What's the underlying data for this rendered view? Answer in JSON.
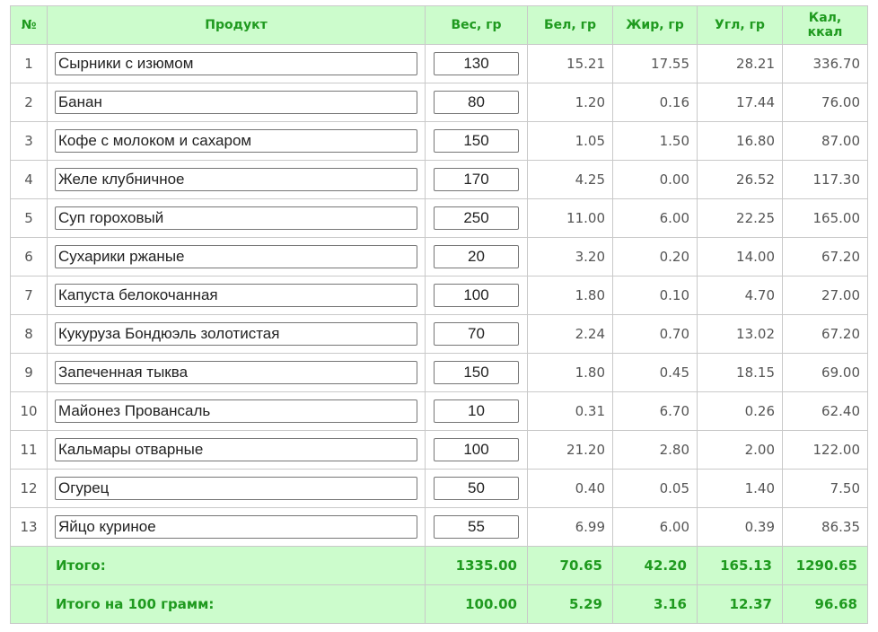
{
  "header": {
    "num": "№",
    "product": "Продукт",
    "weight": "Вес, гр",
    "protein": "Бел, гр",
    "fat": "Жир, гр",
    "carbs": "Угл, гр",
    "kcal": "Кал, ккал"
  },
  "rows": [
    {
      "num": "1",
      "product": "Сырники с изюмом",
      "weight": "130",
      "protein": "15.21",
      "fat": "17.55",
      "carbs": "28.21",
      "kcal": "336.70"
    },
    {
      "num": "2",
      "product": "Банан",
      "weight": "80",
      "protein": "1.20",
      "fat": "0.16",
      "carbs": "17.44",
      "kcal": "76.00"
    },
    {
      "num": "3",
      "product": "Кофе с молоком и сахаром",
      "weight": "150",
      "protein": "1.05",
      "fat": "1.50",
      "carbs": "16.80",
      "kcal": "87.00"
    },
    {
      "num": "4",
      "product": "Желе клубничное",
      "weight": "170",
      "protein": "4.25",
      "fat": "0.00",
      "carbs": "26.52",
      "kcal": "117.30"
    },
    {
      "num": "5",
      "product": "Суп гороховый",
      "weight": "250",
      "protein": "11.00",
      "fat": "6.00",
      "carbs": "22.25",
      "kcal": "165.00"
    },
    {
      "num": "6",
      "product": "Сухарики ржаные",
      "weight": "20",
      "protein": "3.20",
      "fat": "0.20",
      "carbs": "14.00",
      "kcal": "67.20"
    },
    {
      "num": "7",
      "product": "Капуста белокочанная",
      "weight": "100",
      "protein": "1.80",
      "fat": "0.10",
      "carbs": "4.70",
      "kcal": "27.00"
    },
    {
      "num": "8",
      "product": "Кукуруза Бондюэль золотистая",
      "weight": "70",
      "protein": "2.24",
      "fat": "0.70",
      "carbs": "13.02",
      "kcal": "67.20"
    },
    {
      "num": "9",
      "product": "Запеченная тыква",
      "weight": "150",
      "protein": "1.80",
      "fat": "0.45",
      "carbs": "18.15",
      "kcal": "69.00"
    },
    {
      "num": "10",
      "product": "Майонез Провансаль",
      "weight": "10",
      "protein": "0.31",
      "fat": "6.70",
      "carbs": "0.26",
      "kcal": "62.40"
    },
    {
      "num": "11",
      "product": "Кальмары отварные",
      "weight": "100",
      "protein": "21.20",
      "fat": "2.80",
      "carbs": "2.00",
      "kcal": "122.00"
    },
    {
      "num": "12",
      "product": "Огурец",
      "weight": "50",
      "protein": "0.40",
      "fat": "0.05",
      "carbs": "1.40",
      "kcal": "7.50"
    },
    {
      "num": "13",
      "product": "Яйцо куриное",
      "weight": "55",
      "protein": "6.99",
      "fat": "6.00",
      "carbs": "0.39",
      "kcal": "86.35"
    }
  ],
  "totals": {
    "label": "Итого:",
    "weight": "1335.00",
    "protein": "70.65",
    "fat": "42.20",
    "carbs": "165.13",
    "kcal": "1290.65"
  },
  "per100": {
    "label": "Итого на 100 грамм:",
    "weight": "100.00",
    "protein": "5.29",
    "fat": "3.16",
    "carbs": "12.37",
    "kcal": "96.68"
  },
  "colors": {
    "header_bg": "#ccfccc",
    "header_text": "#1f9a1f",
    "border": "#c9c9c9"
  }
}
